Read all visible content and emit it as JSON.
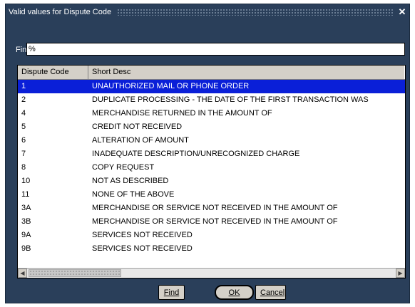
{
  "window": {
    "title": "Valid values for Dispute Code",
    "close_glyph": "✕"
  },
  "find": {
    "label": "Find",
    "value": "%"
  },
  "table": {
    "headers": [
      "Dispute Code",
      "Short Desc"
    ],
    "selected_index": 0,
    "rows": [
      {
        "code": "1",
        "desc": "UNAUTHORIZED MAIL OR PHONE ORDER"
      },
      {
        "code": "2",
        "desc": "DUPLICATE PROCESSING - THE DATE OF THE FIRST TRANSACTION WAS"
      },
      {
        "code": "4",
        "desc": "MERCHANDISE RETURNED IN THE AMOUNT OF"
      },
      {
        "code": "5",
        "desc": "CREDIT NOT RECEIVED"
      },
      {
        "code": "6",
        "desc": "ALTERATION OF AMOUNT"
      },
      {
        "code": "7",
        "desc": "INADEQUATE DESCRIPTION/UNRECOGNIZED CHARGE"
      },
      {
        "code": "8",
        "desc": "COPY REQUEST"
      },
      {
        "code": "10",
        "desc": "NOT AS DESCRIBED"
      },
      {
        "code": "11",
        "desc": "NONE OF THE ABOVE"
      },
      {
        "code": "3A",
        "desc": "MERCHANDISE OR SERVICE NOT RECEIVED IN THE AMOUNT OF"
      },
      {
        "code": "3B",
        "desc": "MERCHANDISE OR SERVICE NOT RECEIVED IN THE AMOUNT OF"
      },
      {
        "code": "9A",
        "desc": "SERVICES NOT RECEIVED"
      },
      {
        "code": "9B",
        "desc": "SERVICES NOT RECEIVED"
      }
    ]
  },
  "scrollbar": {
    "left_icon": "◀",
    "right_icon": "▶"
  },
  "buttons": {
    "find_label": "Find",
    "ok_label": "OK",
    "cancel_label": "Cancel"
  },
  "colors": {
    "window_bg": "#2a3f5a",
    "selection": "#0a1fd8"
  }
}
